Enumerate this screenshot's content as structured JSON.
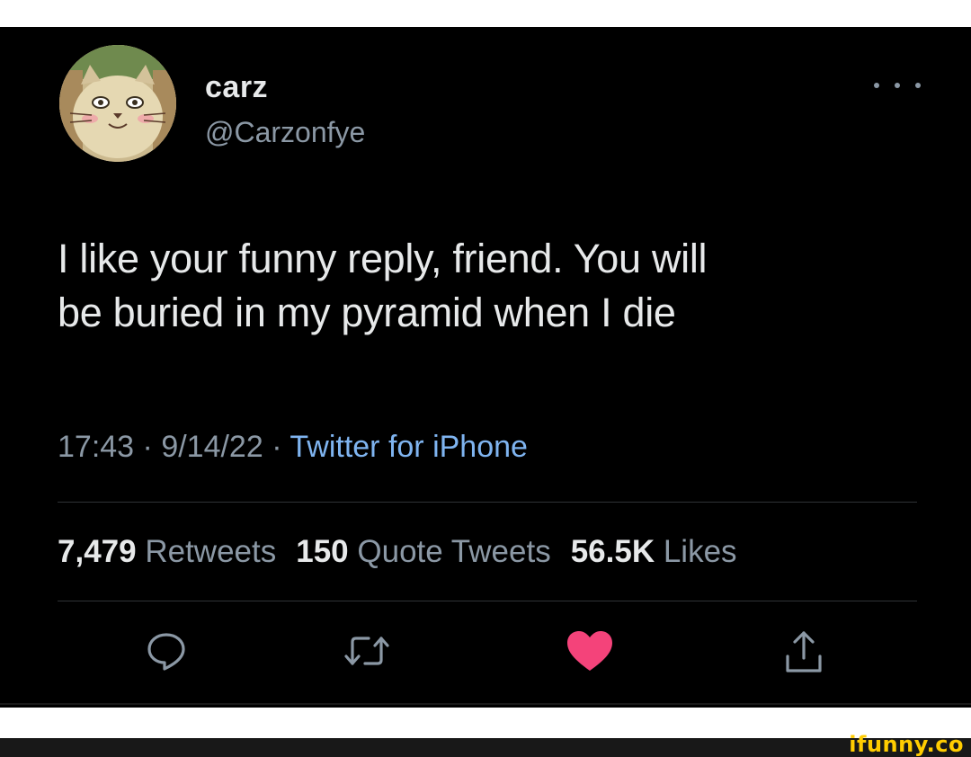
{
  "user": {
    "display_name": "carz",
    "handle": "@Carzonfye"
  },
  "tweet": {
    "text_line1": "I like your funny reply, friend. You will",
    "text_line2": "be buried in my pyramid when I die",
    "time": "17:43",
    "date": "9/14/22",
    "separator": " · ",
    "source": "Twitter for iPhone"
  },
  "stats": {
    "retweets_count": "7,479",
    "retweets_label": "Retweets",
    "quotes_count": "150",
    "quotes_label": "Quote Tweets",
    "likes_count": "56.5K",
    "likes_label": "Likes"
  },
  "actions": {
    "reply_icon": "reply-icon",
    "retweet_icon": "retweet-icon",
    "like_icon": "heart-icon",
    "share_icon": "share-icon"
  },
  "colors": {
    "background": "#000000",
    "text": "#e7e9ea",
    "secondary": "#8b98a5",
    "link": "#7fb4f0",
    "liked": "#f4437a",
    "watermark": "#ffcc00"
  },
  "watermark": "ifunny.co"
}
